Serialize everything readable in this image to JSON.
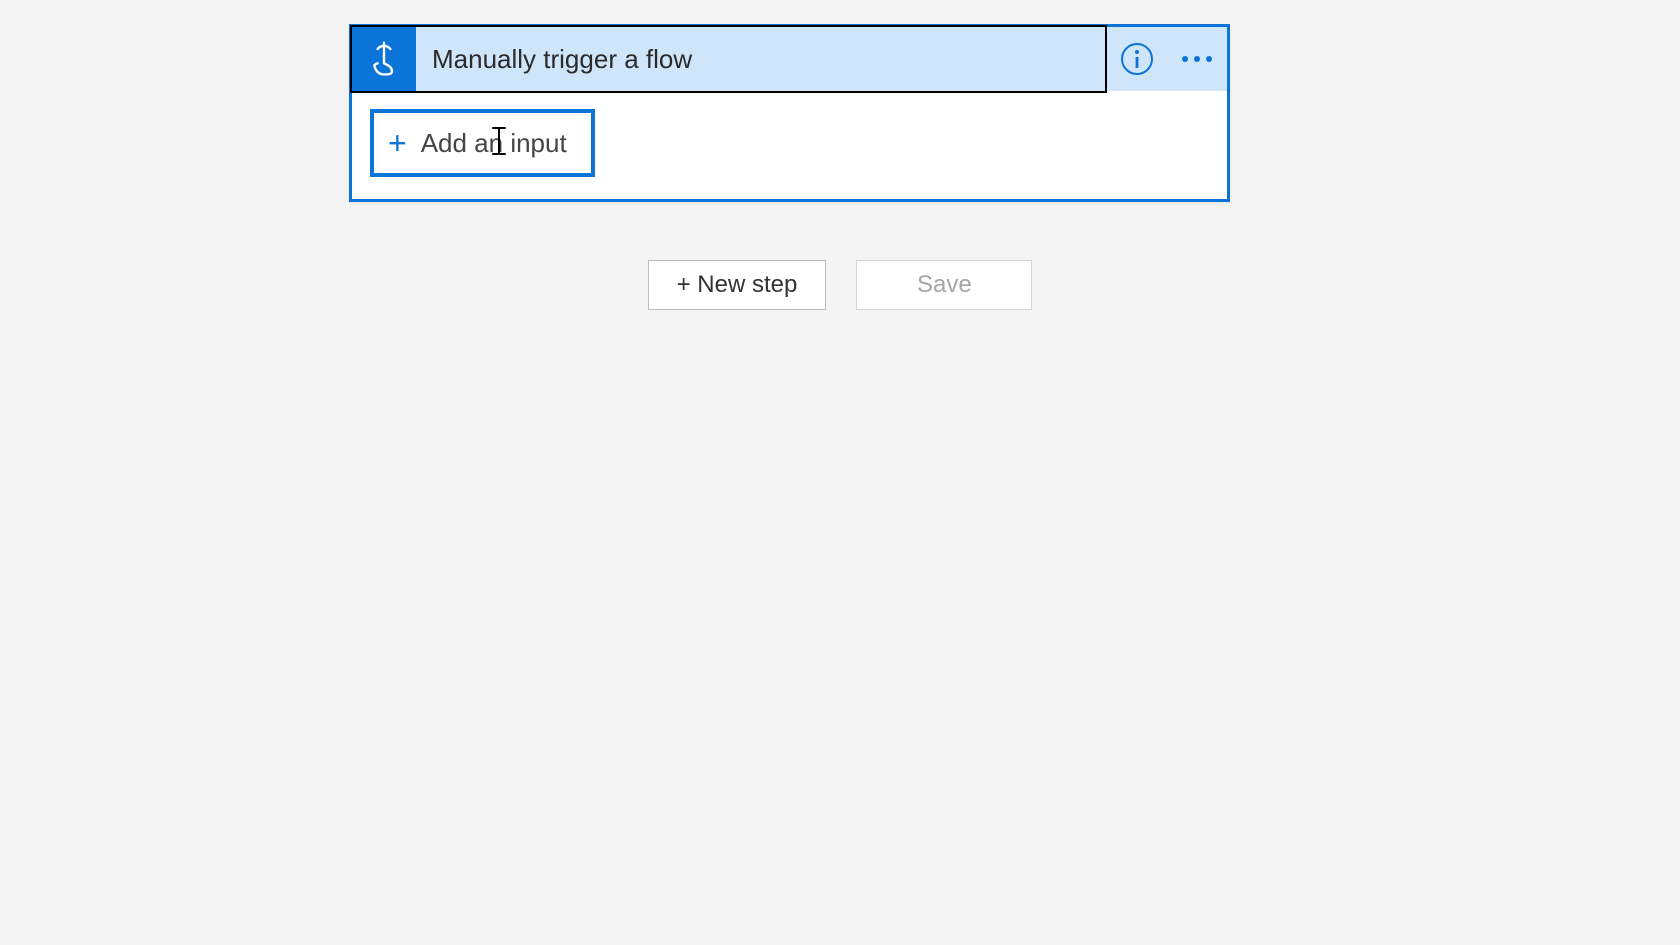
{
  "trigger": {
    "title": "Manually trigger a flow",
    "add_input_label": "Add an input"
  },
  "actions": {
    "new_step": "+ New step",
    "save": "Save"
  }
}
